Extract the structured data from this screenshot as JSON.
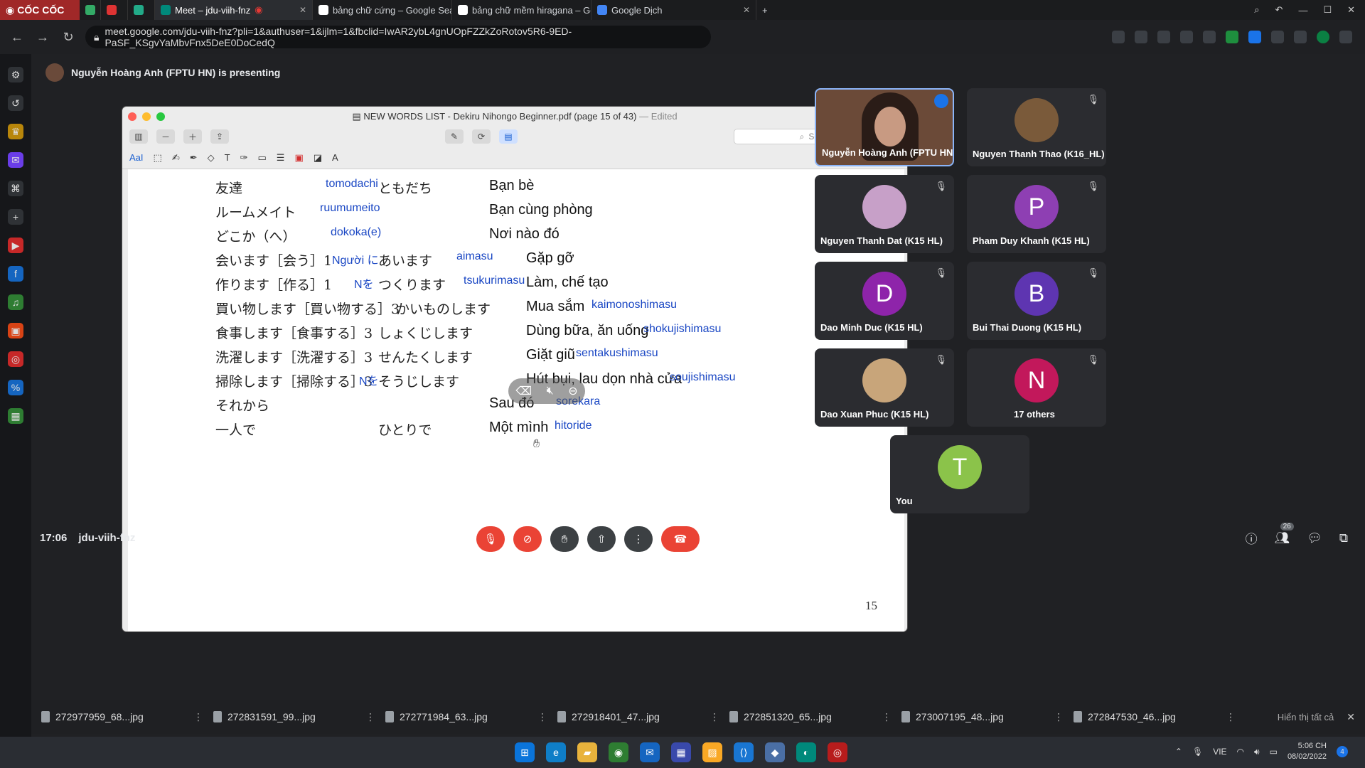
{
  "browser": {
    "brand": "CỐC CỐC",
    "tabs": [
      {
        "label": "Meet – jdu-viih-fnz",
        "active": true
      },
      {
        "label": "bảng chữ cứng – Google Sea",
        "active": false
      },
      {
        "label": "bảng chữ mềm hiragana – Go",
        "active": false
      },
      {
        "label": "Google Dịch",
        "active": false
      }
    ],
    "url": "meet.google.com/jdu-viih-fnz?pli=1&authuser=1&ijlm=1&fbclid=IwAR2ybL4gnUOpFZZkZoRotov5R6-9ED-PaSF_KSgvYaMbvFnx5DeE0DoCedQ"
  },
  "meet": {
    "presenting_text": "Nguyễn Hoàng Anh (FPTU HN) is presenting",
    "time": "17:06",
    "meeting_code": "jdu-viih-fnz",
    "people_badge": "26"
  },
  "presentation": {
    "title": "NEW WORDS LIST - Dekiru Nihongo Beginner.pdf (page 15 of 43)",
    "title_edited": "— Edited",
    "search_placeholder": "Search",
    "page_number": "15",
    "rows": [
      {
        "a": "友達",
        "b": "tomodachi",
        "c": "ともだち",
        "d": "Bạn bè"
      },
      {
        "a": "ルームメイト",
        "b": "ruumumeito",
        "c": "",
        "d": "Bạn cùng phòng"
      },
      {
        "a": "どこか（へ）",
        "b": "dokoka(e)",
        "c": "",
        "d": "Nơi nào đó"
      },
      {
        "a": "会います［会う］1",
        "b": "Người に",
        "c": "あいます",
        "e": "aimasu",
        "d": "Gặp gỡ"
      },
      {
        "a": "作ります［作る］1",
        "b": "Nを",
        "c": "つくります",
        "e": "tsukurimasu",
        "d": "Làm, chế tạo"
      },
      {
        "a": "買い物します［買い物する］3",
        "b": "",
        "c": "かいものします",
        "d": "Mua sắm",
        "e": "kaimonoshimasu"
      },
      {
        "a": "食事します［食事する］3",
        "b": "",
        "c": "しょくじします",
        "d": "Dùng bữa, ăn uống",
        "e": "shokujishimasu"
      },
      {
        "a": "洗濯します［洗濯する］3",
        "b": "",
        "c": "せんたくします",
        "d": "Giặt giũ",
        "e": "sentakushimasu"
      },
      {
        "a": "掃除します［掃除する］3",
        "b": "Nを",
        "c": "そうじします",
        "d": "Hút bụi, lau dọn nhà cửa",
        "e": "soujishimasu"
      },
      {
        "a": "それから",
        "b": "",
        "c": "",
        "d": "Sau đó",
        "e": "sorekara"
      },
      {
        "a": "一人で",
        "b": "",
        "c": "ひとりで",
        "d": "Một mình",
        "e": "hitoride"
      }
    ]
  },
  "participants": [
    {
      "name": "Nguyễn Hoàng Anh (FPTU HN)",
      "presenter": true
    },
    {
      "name": "Nguyen Thanh Thao (K16_HL)",
      "initial": "",
      "color": "#7a5a3a"
    },
    {
      "name": "Nguyen Thanh Dat (K15 HL)",
      "initial": "",
      "color": "#c7a0c8"
    },
    {
      "name": "Pham Duy Khanh (K15 HL)",
      "initial": "P",
      "color": "#8e3fb3"
    },
    {
      "name": "Dao Minh Duc (K15 HL)",
      "initial": "D",
      "color": "#8e24aa"
    },
    {
      "name": "Bui Thai Duong (K15 HL)",
      "initial": "B",
      "color": "#5e35b1"
    },
    {
      "name": "Dao Xuan Phuc (K15 HL)",
      "initial": "",
      "color": "#c8a57a"
    },
    {
      "name": "17 others",
      "initial": "N",
      "color": "#c2185b"
    },
    {
      "name": "You",
      "initial": "T",
      "color": "#8bc34a"
    }
  ],
  "downloads": {
    "files": [
      "272977959_68...jpg",
      "272831591_99...jpg",
      "272771984_63...jpg",
      "272918401_47...jpg",
      "272851320_65...jpg",
      "273007195_48...jpg",
      "272847530_46...jpg"
    ],
    "show_all": "Hiển thị tất cả"
  },
  "taskbar": {
    "language": "VIE",
    "time": "5:06 CH",
    "date": "08/02/2022",
    "notifications": "4"
  }
}
